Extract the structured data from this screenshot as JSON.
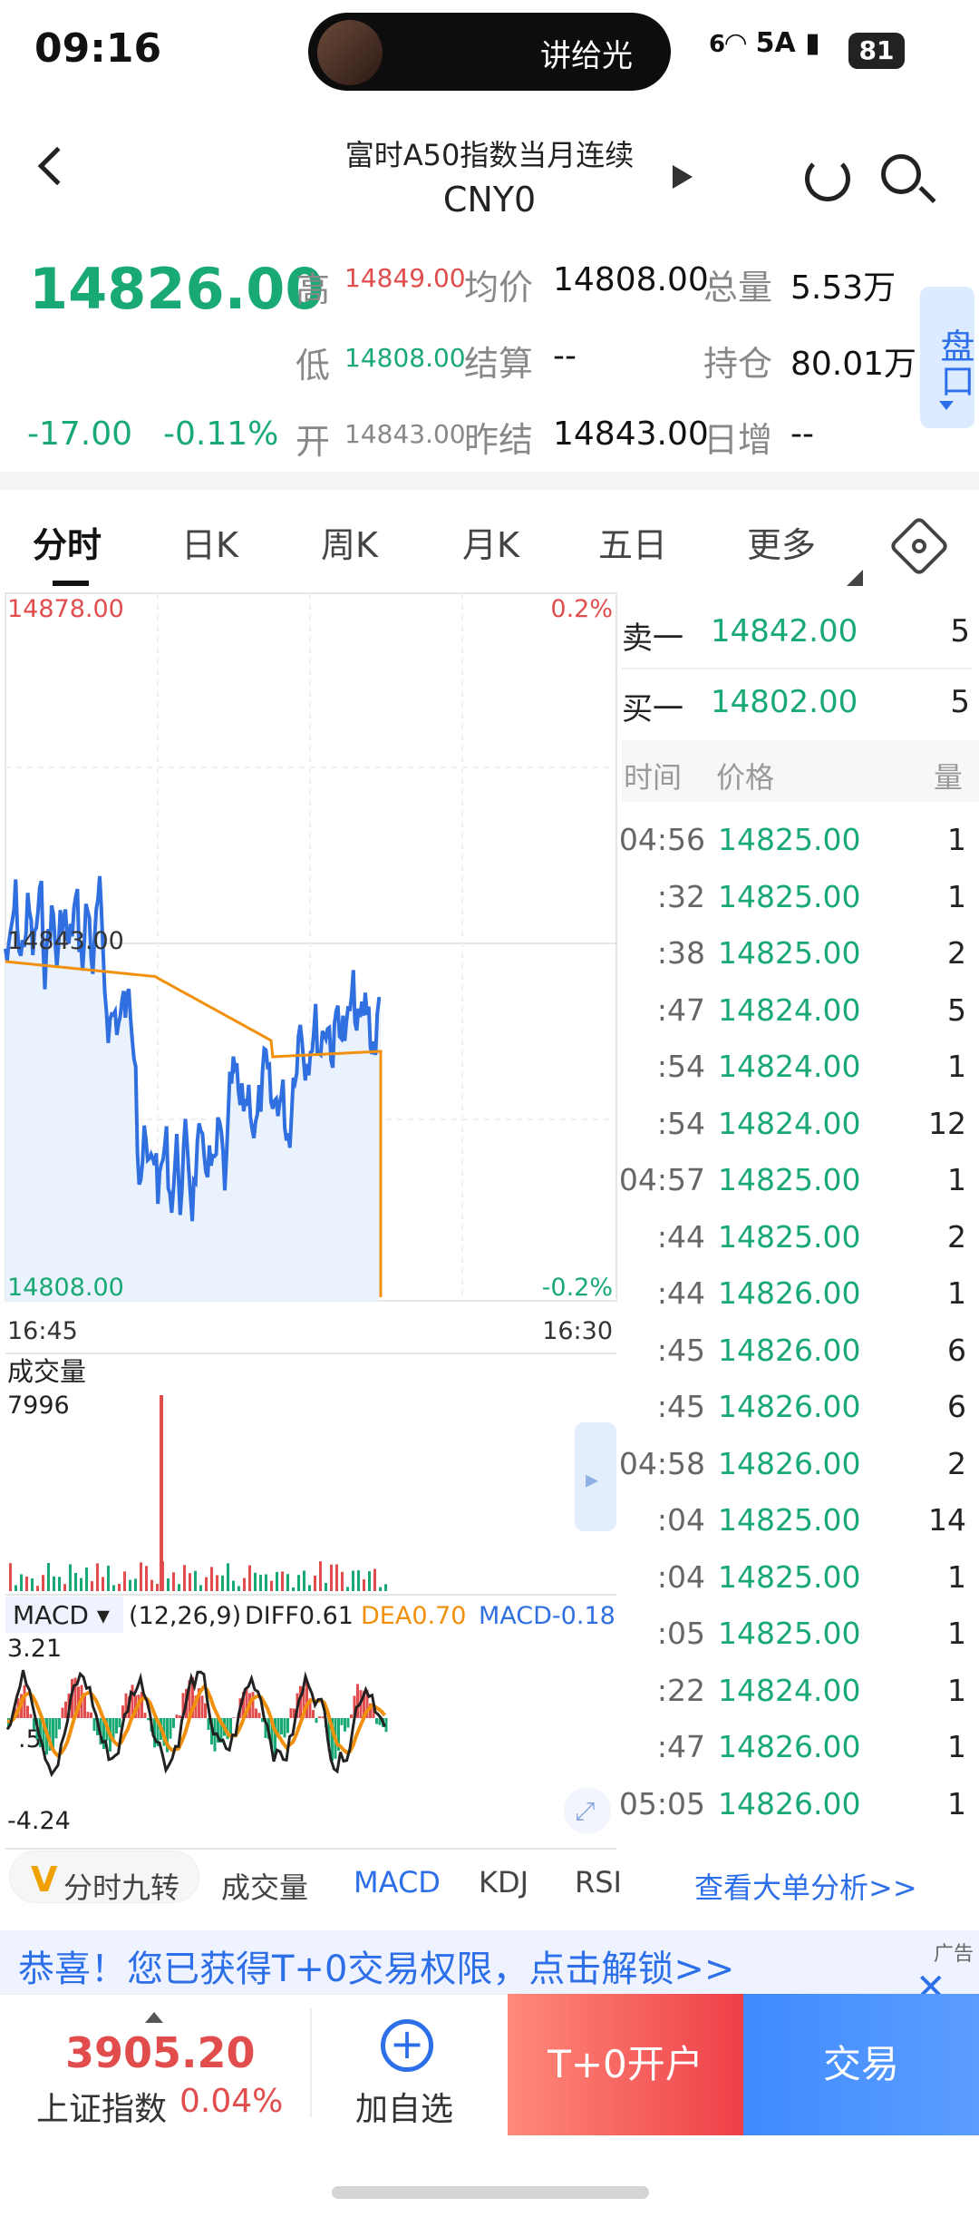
{
  "status": {
    "time": "09:16",
    "pill_text": "讲给光",
    "network": "5A",
    "battery": "81"
  },
  "header": {
    "title": "富时A50指数当月连续",
    "code": "CNY0"
  },
  "quote": {
    "price": "14826.00",
    "change": "-17.00",
    "change_pct": "-0.11%",
    "high_label": "高",
    "high": "14849.00",
    "low_label": "低",
    "low": "14808.00",
    "open_label": "开",
    "open": "14843.00",
    "avg_label": "均价",
    "avg": "14808.00",
    "settle_label": "结算",
    "settle": "--",
    "prev_settle_label": "昨结",
    "prev_settle": "14843.00",
    "total_vol_label": "总量",
    "total_vol": "5.53万",
    "oi_label": "持仓",
    "oi": "80.01万",
    "day_inc_label": "日增",
    "day_inc": "--",
    "pankou": "盘口"
  },
  "tabs": [
    "分时",
    "日K",
    "周K",
    "月K",
    "五日",
    "更多"
  ],
  "chart": {
    "top_price": "14878.00",
    "top_pct": "0.2%",
    "mid_price": "14843.00",
    "bottom_price": "14808.00",
    "bottom_pct": "-0.2%",
    "time_start": "16:45",
    "time_end": "16:30",
    "vol_label": "成交量",
    "vol_max": "7996",
    "macd_label": "MACD ▾",
    "macd_params": "(12,26,9)",
    "diff": "DIFF0.61",
    "dea": "DEA0.70",
    "macd": "MACD-0.18",
    "macd_max": "3.21",
    "macd_mid": ".5",
    "macd_min": "-4.24",
    "colors": {
      "price_line": "#2f6fe0",
      "avg_line": "#f0900c",
      "up": "#e14d4d",
      "down": "#19a974"
    }
  },
  "orderbook": {
    "ask_label": "卖一",
    "ask_price": "14842.00",
    "ask_vol": "5",
    "bid_label": "买一",
    "bid_price": "14802.00",
    "bid_vol": "5",
    "col_time": "时间",
    "col_price": "价格",
    "col_vol": "量",
    "ticks": [
      {
        "t": "04:56",
        "p": "14825.00",
        "v": "1"
      },
      {
        "t": ":32",
        "p": "14825.00",
        "v": "1"
      },
      {
        "t": ":38",
        "p": "14825.00",
        "v": "2"
      },
      {
        "t": ":47",
        "p": "14824.00",
        "v": "5"
      },
      {
        "t": ":54",
        "p": "14824.00",
        "v": "1"
      },
      {
        "t": ":54",
        "p": "14824.00",
        "v": "12"
      },
      {
        "t": "04:57",
        "p": "14825.00",
        "v": "1"
      },
      {
        "t": ":44",
        "p": "14825.00",
        "v": "2"
      },
      {
        "t": ":44",
        "p": "14826.00",
        "v": "1"
      },
      {
        "t": ":45",
        "p": "14826.00",
        "v": "6"
      },
      {
        "t": ":45",
        "p": "14826.00",
        "v": "6"
      },
      {
        "t": "04:58",
        "p": "14826.00",
        "v": "2"
      },
      {
        "t": ":04",
        "p": "14825.00",
        "v": "14"
      },
      {
        "t": ":04",
        "p": "14825.00",
        "v": "1"
      },
      {
        "t": ":05",
        "p": "14825.00",
        "v": "1"
      },
      {
        "t": ":22",
        "p": "14824.00",
        "v": "1"
      },
      {
        "t": ":47",
        "p": "14826.00",
        "v": "1"
      },
      {
        "t": "05:05",
        "p": "14826.00",
        "v": "1"
      }
    ],
    "big_order": "查看大单分析>>"
  },
  "indicators": [
    "分时九转",
    "成交量",
    "MACD",
    "KDJ",
    "RSI"
  ],
  "banner": {
    "text": "恭喜！您已获得T+0交易权限，点击解锁>>",
    "ad": "广告"
  },
  "bottom": {
    "index_value": "3905.20",
    "index_name": "上证指数",
    "index_change": "0.04%",
    "add_label": "加自选",
    "open_label": "T+0开户",
    "trade_label": "交易"
  }
}
